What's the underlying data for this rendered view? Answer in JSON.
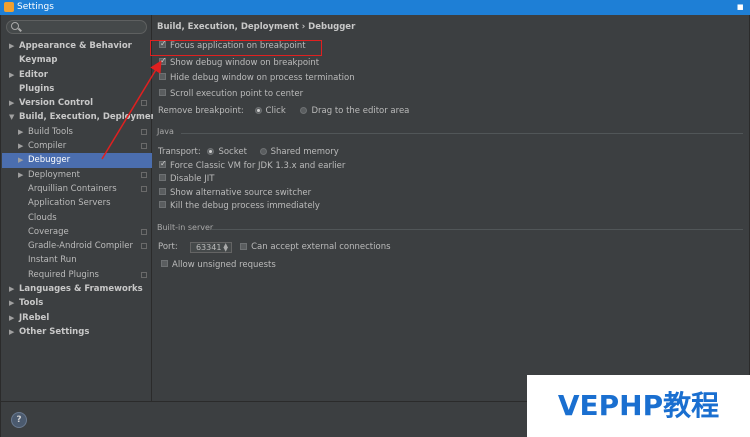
{
  "window": {
    "title": "Settings",
    "close_glyph": "▪"
  },
  "search": {
    "placeholder": "",
    "value": ""
  },
  "sidebar": {
    "items": [
      {
        "label": "Appearance & Behavior",
        "expandable": true,
        "level": 0,
        "bold": true,
        "project_icon": false
      },
      {
        "label": "Keymap",
        "expandable": false,
        "level": 0,
        "bold": true,
        "project_icon": false
      },
      {
        "label": "Editor",
        "expandable": true,
        "level": 0,
        "bold": true,
        "project_icon": false
      },
      {
        "label": "Plugins",
        "expandable": false,
        "level": 0,
        "bold": true,
        "project_icon": false
      },
      {
        "label": "Version Control",
        "expandable": true,
        "level": 0,
        "bold": true,
        "project_icon": true
      },
      {
        "label": "Build, Execution, Deployment",
        "expandable": true,
        "expanded": true,
        "level": 0,
        "bold": true,
        "project_icon": false
      },
      {
        "label": "Build Tools",
        "expandable": true,
        "level": 1,
        "bold": false,
        "project_icon": true
      },
      {
        "label": "Compiler",
        "expandable": true,
        "level": 1,
        "bold": false,
        "project_icon": true
      },
      {
        "label": "Debugger",
        "expandable": true,
        "level": 1,
        "bold": false,
        "project_icon": false,
        "selected": true
      },
      {
        "label": "Deployment",
        "expandable": true,
        "level": 1,
        "bold": false,
        "project_icon": true
      },
      {
        "label": "Arquillian Containers",
        "expandable": false,
        "level": 1,
        "bold": false,
        "project_icon": true
      },
      {
        "label": "Application Servers",
        "expandable": false,
        "level": 1,
        "bold": false,
        "project_icon": false
      },
      {
        "label": "Clouds",
        "expandable": false,
        "level": 1,
        "bold": false,
        "project_icon": false
      },
      {
        "label": "Coverage",
        "expandable": false,
        "level": 1,
        "bold": false,
        "project_icon": true
      },
      {
        "label": "Gradle-Android Compiler",
        "expandable": false,
        "level": 1,
        "bold": false,
        "project_icon": true
      },
      {
        "label": "Instant Run",
        "expandable": false,
        "level": 1,
        "bold": false,
        "project_icon": false
      },
      {
        "label": "Required Plugins",
        "expandable": false,
        "level": 1,
        "bold": false,
        "project_icon": true
      },
      {
        "label": "Languages & Frameworks",
        "expandable": true,
        "level": 0,
        "bold": true,
        "project_icon": false
      },
      {
        "label": "Tools",
        "expandable": true,
        "level": 0,
        "bold": true,
        "project_icon": false
      },
      {
        "label": "JRebel",
        "expandable": true,
        "level": 0,
        "bold": true,
        "project_icon": false
      },
      {
        "label": "Other Settings",
        "expandable": true,
        "level": 0,
        "bold": true,
        "project_icon": false
      }
    ]
  },
  "content": {
    "breadcrumb": "Build, Execution, Deployment › Debugger",
    "focus_app": {
      "label": "Focus application on breakpoint",
      "checked": true
    },
    "show_debug": {
      "label": "Show debug window on breakpoint",
      "checked": true
    },
    "hide_debug": {
      "label": "Hide debug window on process termination",
      "checked": false
    },
    "scroll_exec": {
      "label": "Scroll execution point to center",
      "checked": false
    },
    "remove_bp": {
      "label": "Remove breakpoint:",
      "option_click": "Click",
      "option_drag": "Drag to the editor area",
      "selected": "Click"
    },
    "java_section": "Java",
    "transport": {
      "label": "Transport:",
      "option_socket": "Socket",
      "option_shared": "Shared memory",
      "selected": "Socket"
    },
    "force_classic": {
      "label": "Force Classic VM for JDK 1.3.x and earlier",
      "checked": true
    },
    "disable_jit": {
      "label": "Disable JIT",
      "checked": false
    },
    "alt_switcher": {
      "label": "Show alternative source switcher",
      "checked": false
    },
    "kill_debug": {
      "label": "Kill the debug process immediately",
      "checked": false
    },
    "builtin_section": "Built-in server",
    "port": {
      "label": "Port:",
      "value": "63341"
    },
    "external": {
      "label": "Can accept external connections",
      "checked": false
    },
    "unsigned": {
      "label": "Allow unsigned requests",
      "checked": false
    }
  },
  "bottom": {
    "help_label": "?"
  },
  "watermark": "VEPHP教程",
  "colors": {
    "selection": "#4b6eaf",
    "titlebar": "#1e7fd6",
    "annotation": "#e02020",
    "watermark": "#1a6fd0"
  }
}
